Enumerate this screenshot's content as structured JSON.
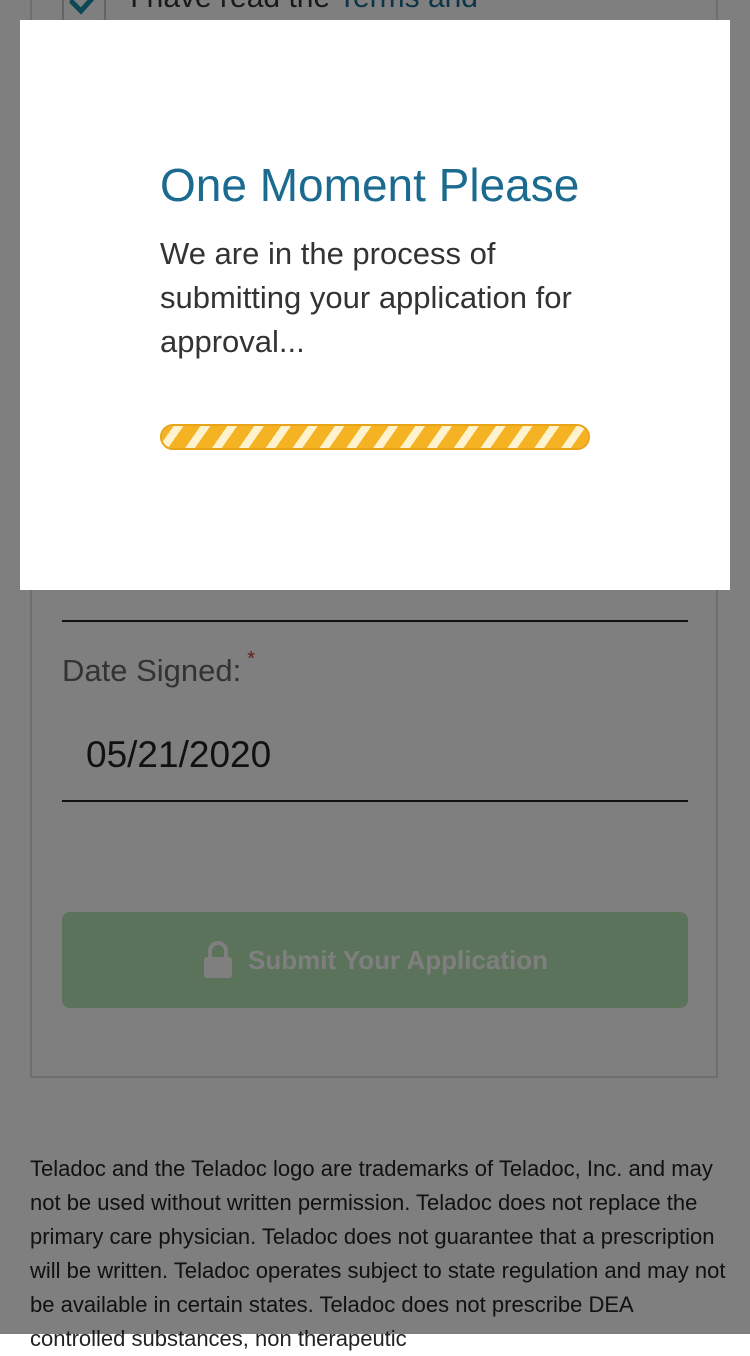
{
  "terms": {
    "prefix": "I have read the ",
    "link": "Terms and"
  },
  "form": {
    "signature_value": "",
    "date_label": "Date Signed:",
    "required_mark": "*",
    "date_value": "05/21/2020",
    "submit_label": "Submit Your Application"
  },
  "footer": {
    "text": "Teladoc and the Teladoc logo are trademarks of Teladoc, Inc. and may not be used without written permission. Teladoc does not replace the primary care physician. Teladoc does not guarantee that a prescription will be written. Teladoc operates subject to state regulation and may not be available in certain states. Teladoc does not prescribe DEA controlled substances, non therapeutic"
  },
  "modal": {
    "title": "One Moment Please",
    "message": "We are in the process of submitting your application for approval...",
    "progress": 1.0
  },
  "colors": {
    "accent": "#1a6b8f",
    "progress": "#f5b324",
    "button": "#b6e7b6"
  },
  "icons": {
    "checkbox": "check-icon",
    "submit": "lock-icon"
  }
}
